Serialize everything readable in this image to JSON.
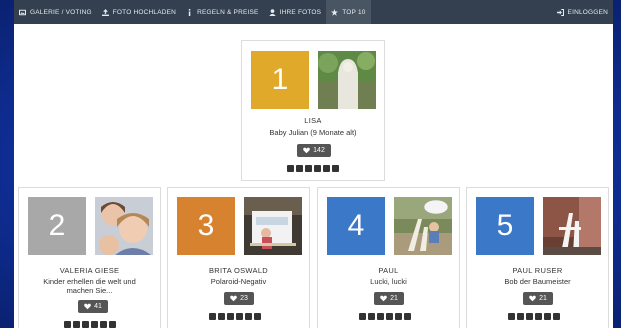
{
  "nav": {
    "items": [
      {
        "label": "GALERIE / VOTING",
        "icon": "gallery-icon"
      },
      {
        "label": "FOTO HOCHLADEN",
        "icon": "upload-icon"
      },
      {
        "label": "REGELN & PREISE",
        "icon": "info-icon"
      },
      {
        "label": "IHRE FOTOS",
        "icon": "user-icon"
      },
      {
        "label": "TOP 10",
        "icon": "star-icon"
      }
    ],
    "login": {
      "label": "EINLOGGEN",
      "icon": "login-icon"
    }
  },
  "entries": [
    {
      "rank": "1",
      "name": "LISA",
      "title": "Baby Julian (9 Monate alt)",
      "votes": "142",
      "color": "#e1a92a"
    },
    {
      "rank": "2",
      "name": "VALERIA GIESE",
      "title": "Kinder erhellen die welt und machen Sie...",
      "votes": "41",
      "color": "#a8a8a8"
    },
    {
      "rank": "3",
      "name": "BRITA OSWALD",
      "title": "Polaroid-Negativ",
      "votes": "23",
      "color": "#d6822e"
    },
    {
      "rank": "4",
      "name": "PAUL",
      "title": "Lucki, lucki",
      "votes": "21",
      "color": "#3c78c8"
    },
    {
      "rank": "5",
      "name": "PAUL RUSER",
      "title": "Bob der Baumeister",
      "votes": "21",
      "color": "#3c78c8"
    }
  ],
  "share_icons": [
    "facebook-icon",
    "twitter-icon",
    "googleplus-icon",
    "tumblr-icon",
    "pinterest-icon",
    "email-icon"
  ]
}
